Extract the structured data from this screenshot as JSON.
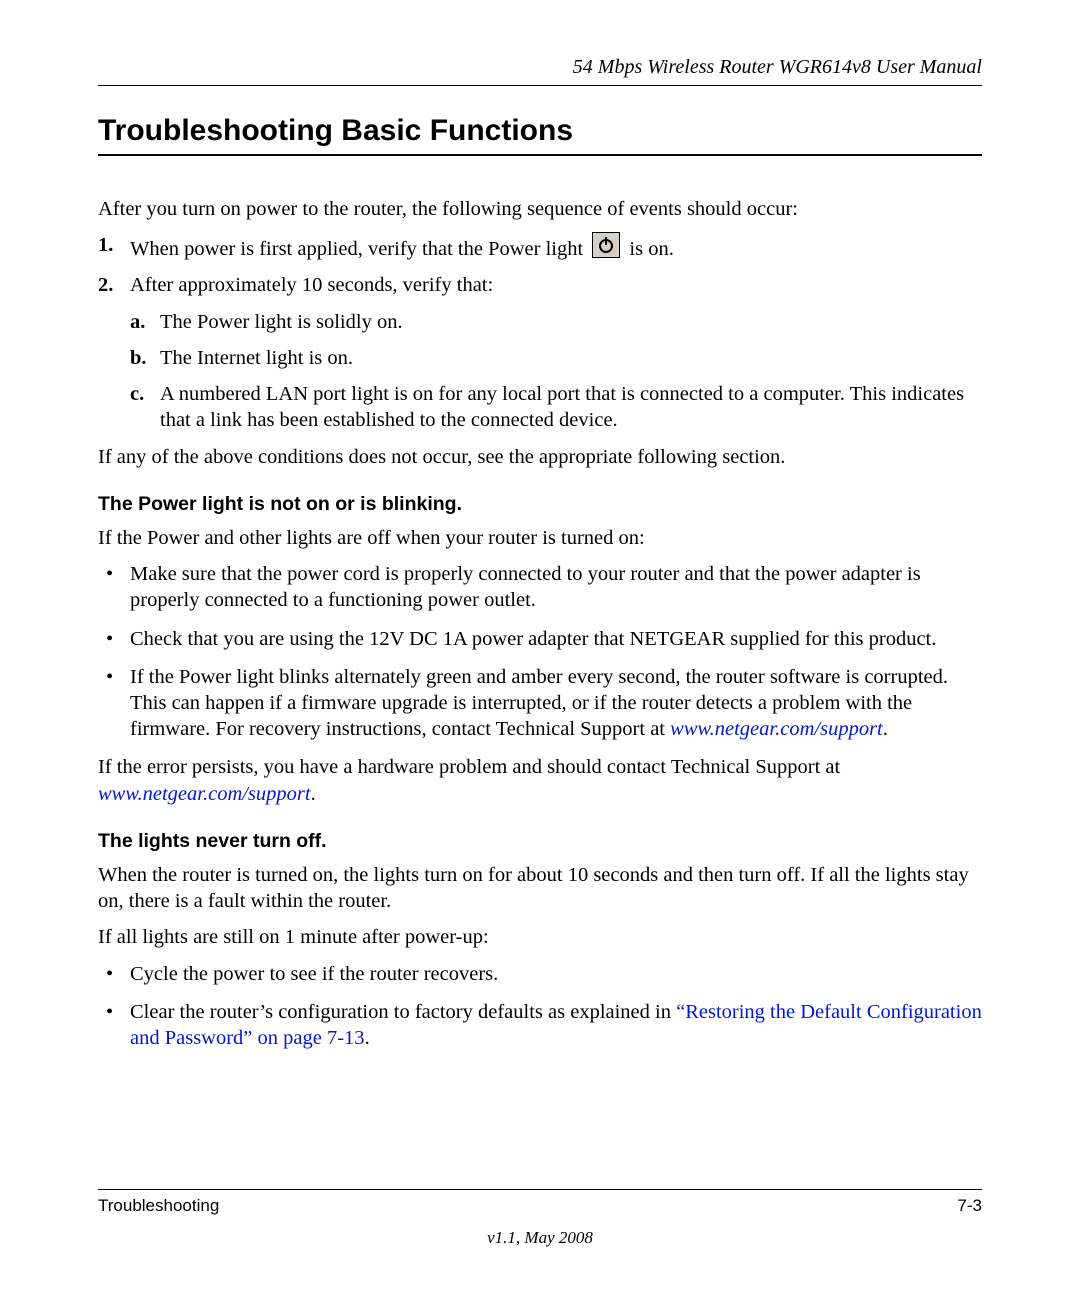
{
  "header": {
    "running_title": "54 Mbps Wireless Router WGR614v8 User Manual"
  },
  "title": "Troubleshooting Basic Functions",
  "intro": "After you turn on power to the router, the following sequence of events should occur:",
  "steps": {
    "s1_marker": "1.",
    "s1_pre": "When power is first applied, verify that the Power light ",
    "s1_post": " is on.",
    "s2_marker": "2.",
    "s2_text": "After approximately 10 seconds, verify that:",
    "s2a_marker": "a.",
    "s2a_text": "The Power light is solidly on.",
    "s2b_marker": "b.",
    "s2b_text": "The Internet light is on.",
    "s2c_marker": "c.",
    "s2c_text": "A numbered LAN port light is on for any local port that is connected to a computer. This indicates that a link has been established to the connected device."
  },
  "after_steps": "If any of the above conditions does not occur, see the appropriate following section.",
  "section1": {
    "heading": "The Power light is not on or is blinking.",
    "lead": "If the Power and other lights are off when your router is turned on:",
    "b1": "Make sure that the power cord is properly connected to your router and that the power adapter is properly connected to a functioning power outlet.",
    "b2": "Check that you are using the 12V DC 1A power adapter that NETGEAR supplied for this product.",
    "b3_pre": "If the Power light blinks alternately green and amber every second, the router software is corrupted. This can happen if a firmware upgrade is interrupted, or if the router detects a problem with the firmware. For recovery instructions, contact Technical Support at ",
    "support_link": "www.netgear.com/support",
    "b3_post": ".",
    "tail_pre": "If the error persists, you have a hardware problem and should contact Technical Support at ",
    "tail_post": "."
  },
  "section2": {
    "heading": "The lights never turn off.",
    "p1": "When the router is turned on, the lights turn on for about 10 seconds and then turn off. If all the lights stay on, there is a fault within the router.",
    "p2": "If all lights are still on 1 minute after power-up:",
    "b1": "Cycle the power to see if the router recovers.",
    "b2_pre": "Clear the router’s configuration to factory defaults as explained in ",
    "xref": "“Restoring the Default Configuration and Password” on page 7-13",
    "b2_post": "."
  },
  "footer": {
    "section_name": "Troubleshooting",
    "page_number": "7-3",
    "version": "v1.1, May 2008"
  }
}
